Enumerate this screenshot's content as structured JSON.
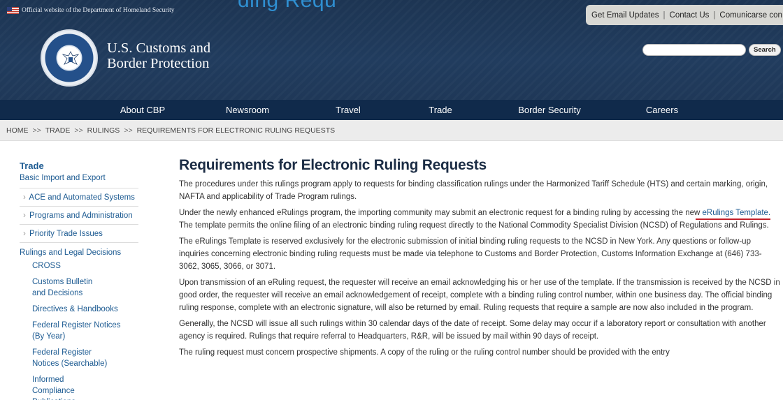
{
  "header": {
    "cut_title": "ding Requ",
    "official_notice": "Official website of the Department of Homeland Security",
    "utility_links": [
      "Get Email Updates",
      "Contact Us",
      "Comunicarse con Nosotr"
    ],
    "brand_line1": "U.S. Customs and",
    "brand_line2": "Border Protection",
    "search": {
      "placeholder": "",
      "button": "Search"
    }
  },
  "nav": {
    "items": [
      "About CBP",
      "Newsroom",
      "Travel",
      "Trade",
      "Border Security",
      "Careers"
    ]
  },
  "breadcrumb": {
    "items": [
      "HOME",
      "TRADE",
      "RULINGS",
      "REQUIREMENTS FOR ELECTRONIC RULING REQUESTS"
    ],
    "separator": ">>"
  },
  "sidebar": {
    "title": "Trade",
    "basic": "Basic Import and Export",
    "rows": [
      "ACE and Automated Systems",
      "Programs and Administration",
      "Priority Trade Issues"
    ],
    "section": "Rulings and Legal Decisions",
    "subitems": [
      "CROSS",
      "Customs Bulletin and Decisions",
      "Directives & Handbooks",
      "Federal Register Notices (By Year)",
      "Federal Register Notices (Searchable)",
      "Informed Compliance Publications"
    ]
  },
  "main": {
    "title": "Requirements for Electronic Ruling Requests",
    "p1": "The procedures under this rulings program apply to requests for binding classification rulings under the Harmonized Tariff Schedule (HTS) and certain marking, origin, NAFTA and applicability of Trade Program rulings.",
    "p2_before": "Under the newly enhanced eRulings program, the importing community may submit an electronic request for a binding ruling by accessing the new ",
    "p2_link": "eRulings Template.",
    "p2_after": " The template permits the online filing of an electronic binding ruling request directly to the National Commodity Specialist Division (NCSD) of Regulations and Rulings.",
    "p3": "The eRulings Template is reserved exclusively for the electronic submission of initial binding ruling requests to the NCSD in New York. Any questions or follow-up inquiries concerning electronic binding ruling requests must be made via telephone to Customs and Border Protection, Customs Information Exchange at (646) 733-3062, 3065, 3066, or 3071.",
    "p4": "Upon transmission of an eRuling request, the requester will receive an email acknowledging his or her use of the template. If the transmission is received by the NCSD in good order, the requester will receive an email acknowledgement of receipt, complete with a binding ruling control number, within one business day. The official binding ruling response, complete with an electronic signature, will also be returned by email. Ruling requests that require a sample are now also included in the program.",
    "p5": "Generally, the NCSD will issue all such rulings within 30 calendar days of the date of receipt. Some delay may occur if a laboratory report or consultation with another agency is required. Rulings that require referral to Headquarters, R&R, will be issued by mail within 90 days of receipt.",
    "p6": "The ruling request must concern prospective shipments. A copy of the ruling or the ruling control number should be provided with the entry"
  },
  "colors": {
    "header_bg": "#213c5e",
    "nav_bg": "#102a4b",
    "link": "#1d5b92",
    "highlight_underline": "#c3202a"
  }
}
